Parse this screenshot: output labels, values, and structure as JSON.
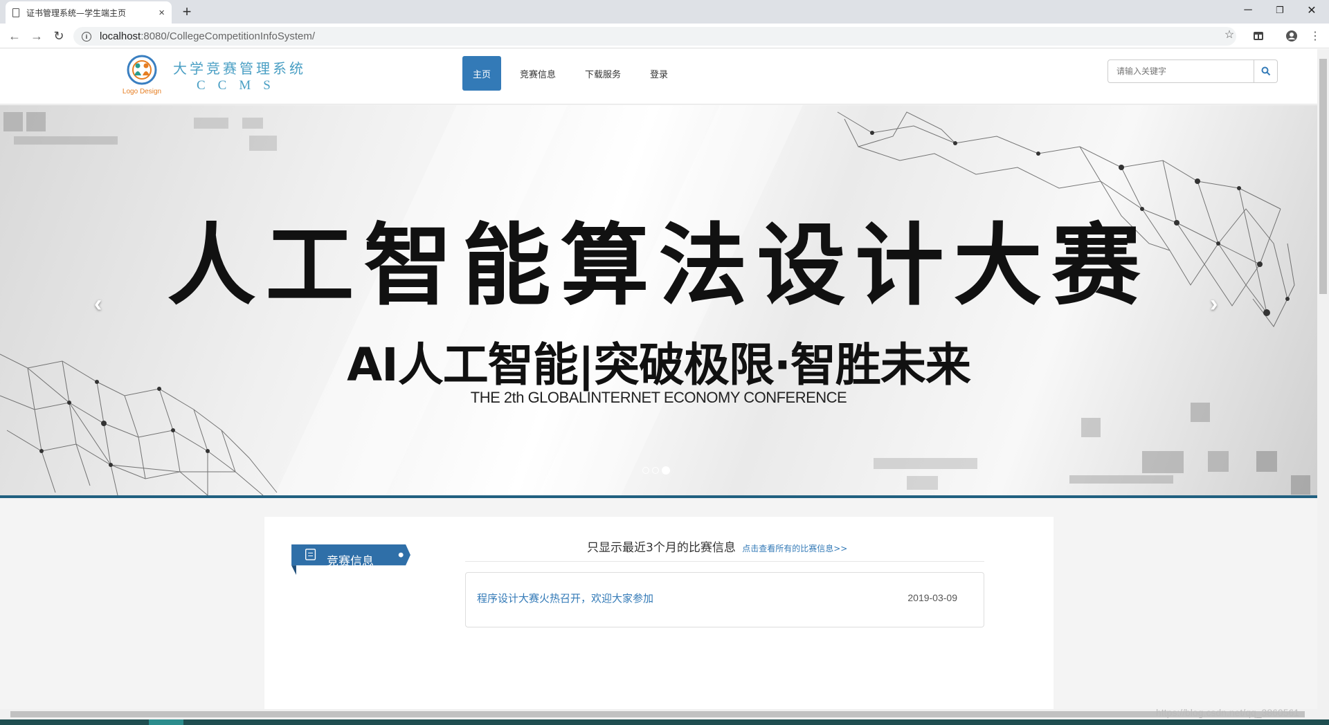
{
  "browser": {
    "tab_title": "证书管理系统—学生端主页",
    "tab_close": "×",
    "new_tab": "+",
    "url_host": "localhost",
    "url_path": ":8080/CollegeCompetitionInfoSystem/",
    "back_icon": "←",
    "forward_icon": "→",
    "reload_icon": "↻",
    "info_icon": "i",
    "star_icon": "☆",
    "menu_icon": "⋮",
    "minimize_icon": "─",
    "restore_icon": "❐",
    "close_icon": "✕"
  },
  "site": {
    "logo_caption": "Logo Design",
    "logo_cn": "大学竞赛管理系统",
    "logo_en": "CCMS",
    "nav": [
      {
        "label": "主页",
        "active": true
      },
      {
        "label": "竞赛信息",
        "active": false
      },
      {
        "label": "下载服务",
        "active": false
      },
      {
        "label": "登录",
        "active": false
      }
    ],
    "search_placeholder": "请输入关键字"
  },
  "carousel": {
    "headline": "人工智能算法设计大赛",
    "subline": "AI人工智能|突破极限·智胜未来",
    "conference": "THE 2th GLOBALINTERNET ECONOMY CONFERENCE",
    "prev": "‹",
    "next": "›",
    "slide_count": 3,
    "active_slide": 3
  },
  "content": {
    "section_label": "竞赛信息",
    "recent_title": "只显示最近3个月的比赛信息",
    "recent_link": "点击查看所有的比赛信息>>",
    "items": [
      {
        "title": "程序设计大赛火热召开，欢迎大家参加",
        "date": "2019-03-09"
      }
    ]
  },
  "watermark": "https://blog.csdn.net/qq_3860561"
}
